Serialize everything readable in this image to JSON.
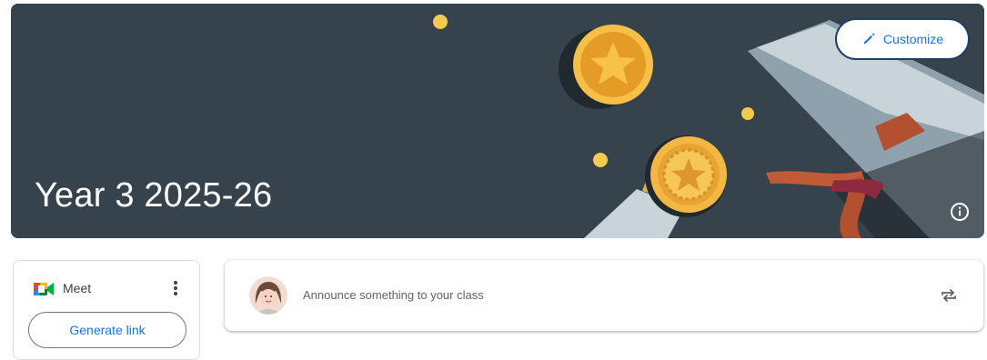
{
  "banner": {
    "class_title": "Year 3 2025-26",
    "background_color": "#36434c",
    "customize_label": "Customize",
    "customize_icon": "pencil-icon",
    "info_icon": "info-icon"
  },
  "meet": {
    "label": "Meet",
    "icon": "google-meet-icon",
    "menu_icon": "more-vert-icon",
    "generate_link_label": "Generate link"
  },
  "stream": {
    "announce_placeholder": "Announce something to your class",
    "avatar_icon": "user-avatar",
    "repost_icon": "repost-icon"
  },
  "colors": {
    "accent": "#1a73e8",
    "border": "#dadce0",
    "customize_border": "#1f3f63"
  }
}
